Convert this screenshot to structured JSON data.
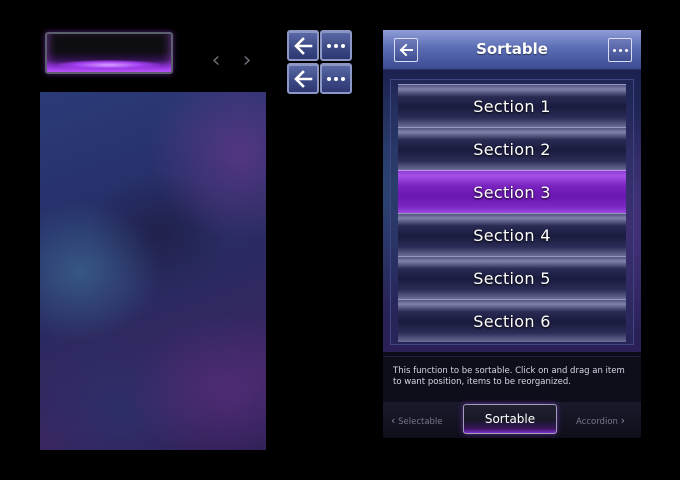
{
  "preview": {
    "glow_button_label": "",
    "nav_prev": "‹",
    "nav_next": "›"
  },
  "icons": [
    "back-arrow-icon",
    "more-dots-icon"
  ],
  "phone": {
    "title": "Sortable",
    "sections": [
      "Section 1",
      "Section 2",
      "Section 3",
      "Section 4",
      "Section 5",
      "Section 6"
    ],
    "active_section": "Section 3",
    "description": "This function to be sortable. Click on and drag an item to want position, items to be reorganized.",
    "tabs": {
      "prev": "Selectable",
      "current": "Sortable",
      "next": "Accordion"
    }
  },
  "colors": {
    "accent": "#8a35d6",
    "header": "#5b6db3",
    "background": "#000000"
  }
}
